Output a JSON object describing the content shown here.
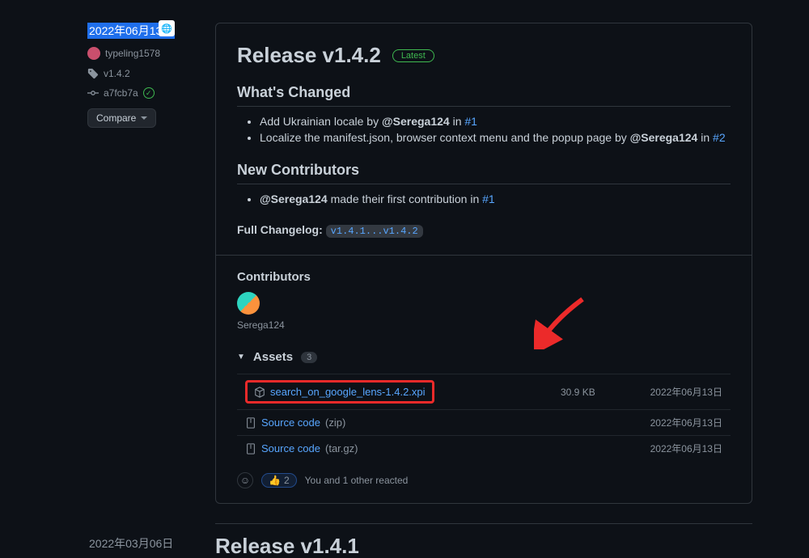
{
  "sidebar": {
    "date_selected": "2022年06月13日",
    "author": "typeling1578",
    "tag": "v1.4.2",
    "commit": "a7fcb7a",
    "compare_label": "Compare"
  },
  "release": {
    "title": "Release v1.4.2",
    "latest_label": "Latest",
    "whats_changed_heading": "What's Changed",
    "changes": [
      {
        "text_pre": "Add Ukrainian locale by ",
        "mention": "@Serega124",
        "text_in": " in ",
        "link": "#1"
      },
      {
        "text_pre": "Localize the manifest.json, browser context menu and the popup page by ",
        "mention": "@Serega124",
        "text_in": " in ",
        "link": "#2"
      }
    ],
    "new_contrib_heading": "New Contributors",
    "new_contrib": {
      "mention": "@Serega124",
      "text": " made their first contribution in ",
      "link": "#1"
    },
    "full_changelog_label": "Full Changelog",
    "full_changelog_range": "v1.4.1...v1.4.2",
    "contributors_heading": "Contributors",
    "contributor_name": "Serega124",
    "assets_heading": "Assets",
    "assets_count": "3",
    "assets": [
      {
        "name": "search_on_google_lens-1.4.2.xpi",
        "highlighted": true,
        "size": "30.9 KB",
        "date": "2022年06月13日"
      },
      {
        "name": "Source code",
        "suffix": " (zip)",
        "size": "",
        "date": "2022年06月13日"
      },
      {
        "name": "Source code",
        "suffix": " (tar.gz)",
        "size": "",
        "date": "2022年06月13日"
      }
    ],
    "reaction_emoji": "👍",
    "reaction_count": "2",
    "reaction_text": "You and 1 other reacted"
  },
  "next": {
    "date": "2022年03月06日",
    "title": "Release v1.4.1"
  }
}
